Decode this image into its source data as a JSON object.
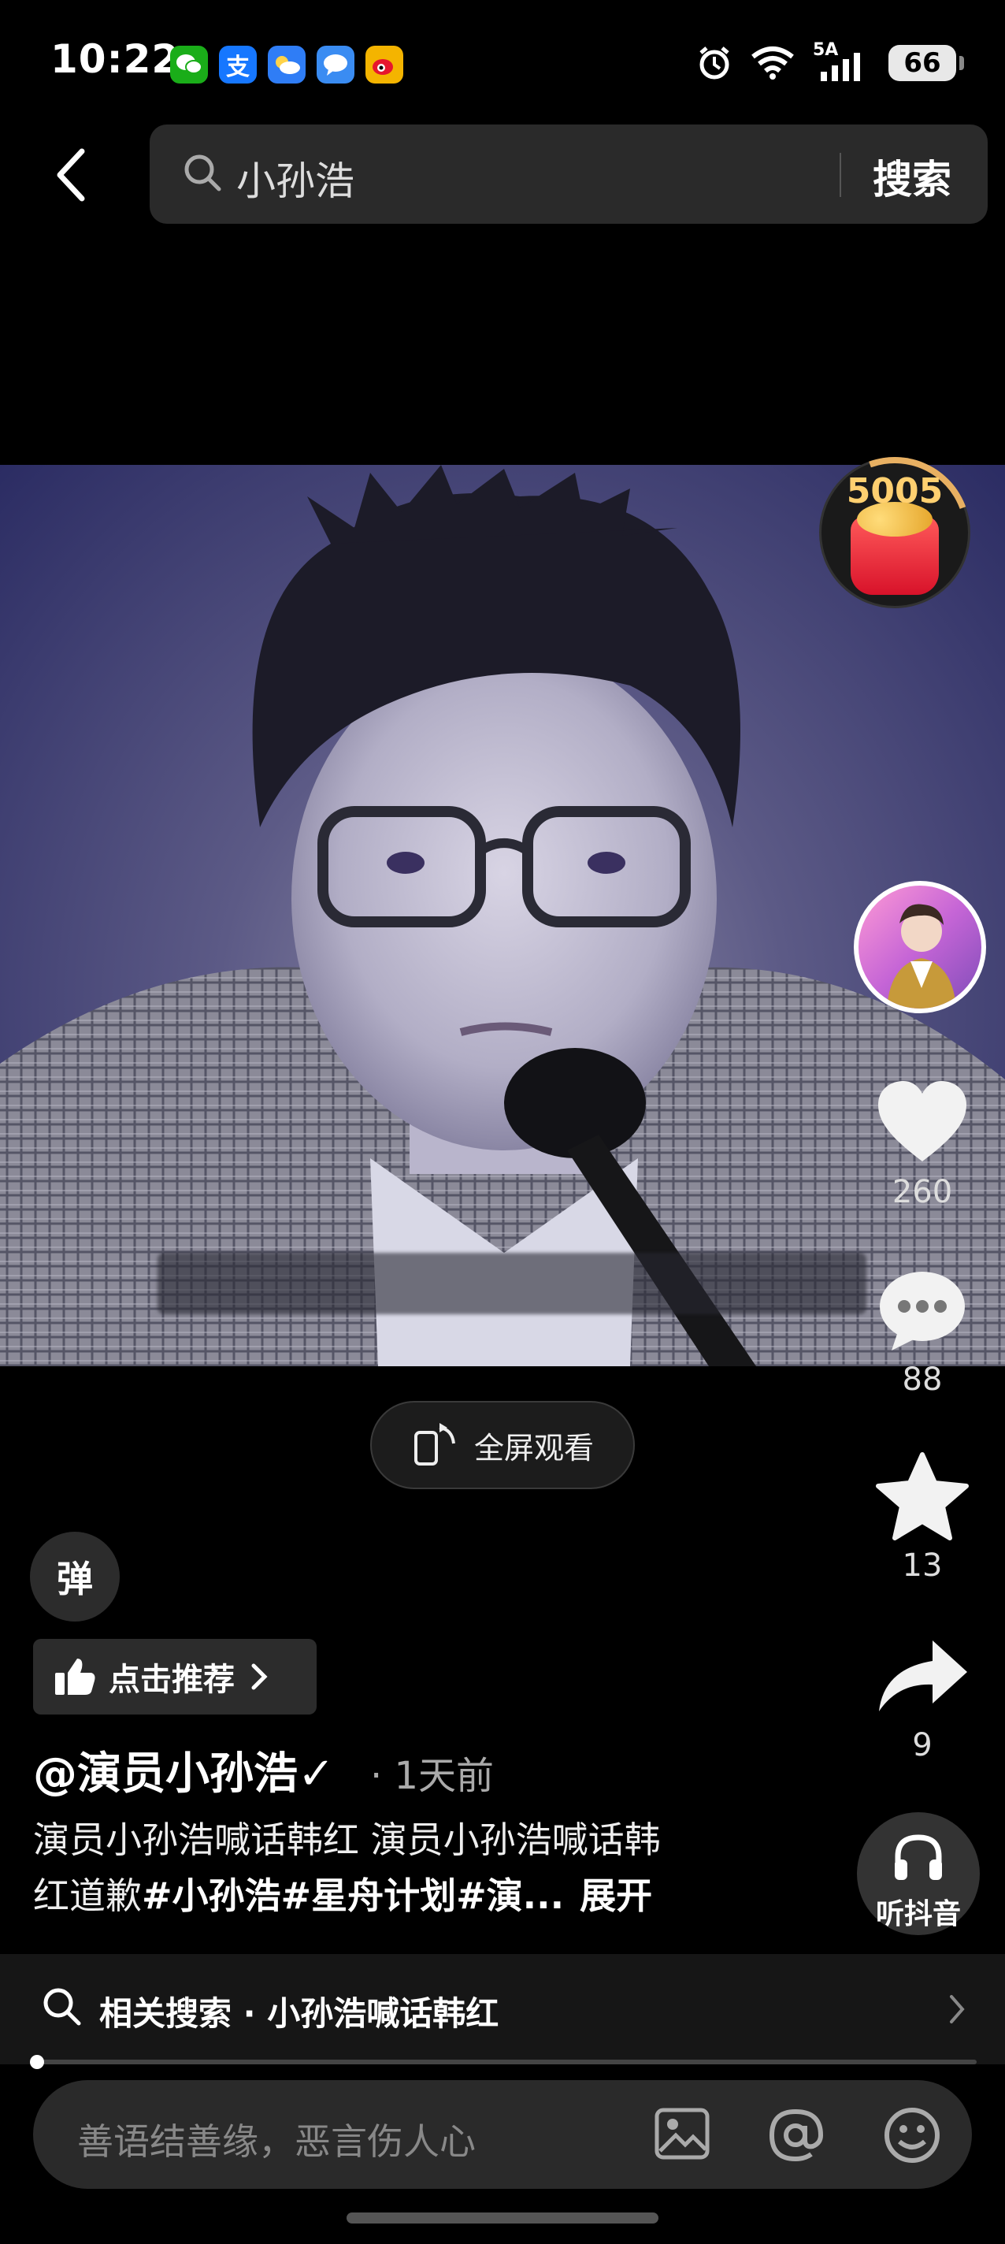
{
  "status_bar": {
    "time": "10:22",
    "network": "5A",
    "battery": "66",
    "apps": [
      {
        "name": "wechat-icon",
        "glyph": "✆",
        "color": "#1aad19"
      },
      {
        "name": "alipay-icon",
        "glyph": "支",
        "color": "#1677ff"
      },
      {
        "name": "weather-icon",
        "glyph": "☁",
        "color": "#2f7df6"
      },
      {
        "name": "messages-icon",
        "glyph": "●",
        "color": "#3a8cf2"
      },
      {
        "name": "weibo-icon",
        "glyph": "◉",
        "color": "#f4b400"
      }
    ]
  },
  "search": {
    "query": "小孙浩",
    "submit_label": "搜索"
  },
  "coin_widget": {
    "count": "5005"
  },
  "rail": {
    "likes": "260",
    "comments": "88",
    "favorites": "13",
    "shares": "9",
    "listen_label": "听抖音"
  },
  "fullscreen_label": "全屏观看",
  "danmu_label": "弹",
  "recommend_label": "点击推荐",
  "post": {
    "author": "@演员小孙浩✓",
    "time_ago": "· 1天前",
    "desc_line1": "演员小孙浩喊话韩红 演员小孙浩喊话韩",
    "desc_line2_plain": "红道歉",
    "desc_line2_tags": "#小孙浩#星舟计划#演...",
    "expand_label": "展开"
  },
  "related_search": {
    "label": "相关搜索 · 小孙浩喊话韩红"
  },
  "comment_input": {
    "placeholder": "善语结善缘，恶言伤人心"
  },
  "colors": {
    "background": "#000000",
    "panel": "#2a2a2a",
    "coin_gold": "#ffd070"
  }
}
